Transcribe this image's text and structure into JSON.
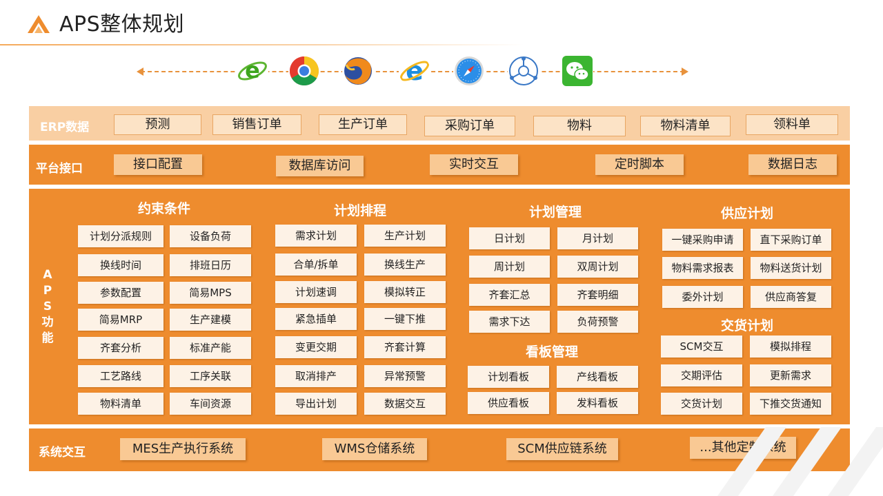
{
  "title": "APS整体规划",
  "colors": {
    "accent": "#ee8c2e",
    "light_band": "#f9cfa3",
    "cell": "#fdf2e6"
  },
  "browser_icons": [
    "ie-green-e-icon",
    "chrome-icon",
    "firefox-icon",
    "ie-blue-e-icon",
    "safari-icon",
    "network-hub-icon",
    "wechat-icon"
  ],
  "erp": {
    "label": "ERP数据",
    "items": [
      "预测",
      "销售订单",
      "生产订单",
      "采购订单",
      "物料",
      "物料清单",
      "领料单"
    ]
  },
  "platform": {
    "label": "平台接口",
    "items": [
      "接口配置",
      "数据库访问",
      "实时交互",
      "定时脚本",
      "数据日志"
    ]
  },
  "aps": {
    "label": [
      "A",
      "P",
      "S",
      "功",
      "能"
    ],
    "constraints": {
      "title": "约束条件",
      "items": [
        "计划分派规则",
        "设备负荷",
        "换线时间",
        "排班日历",
        "参数配置",
        "简易MPS",
        "简易MRP",
        "生产建模",
        "齐套分析",
        "标准产能",
        "工艺路线",
        "工序关联",
        "物料清单",
        "车间资源"
      ]
    },
    "scheduling": {
      "title": "计划排程",
      "items": [
        "需求计划",
        "生产计划",
        "合单/拆单",
        "换线生产",
        "计划速调",
        "模拟转正",
        "紧急插单",
        "一键下推",
        "变更交期",
        "齐套计算",
        "取消排产",
        "异常预警",
        "导出计划",
        "数据交互"
      ]
    },
    "plan_mgmt": {
      "title": "计划管理",
      "items": [
        "日计划",
        "月计划",
        "周计划",
        "双周计划",
        "齐套汇总",
        "齐套明细",
        "需求下达",
        "负荷预警"
      ]
    },
    "kanban": {
      "title": "看板管理",
      "items": [
        "计划看板",
        "产线看板",
        "供应看板",
        "发料看板"
      ]
    },
    "supply": {
      "title": "供应计划",
      "items": [
        "一键采购申请",
        "直下采购订单",
        "物料需求报表",
        "物料送货计划",
        "委外计划",
        "供应商答复"
      ]
    },
    "delivery": {
      "title": "交货计划",
      "items": [
        "SCM交互",
        "模拟排程",
        "交期评估",
        "更新需求",
        "交货计划",
        "下推交货通知"
      ]
    }
  },
  "system": {
    "label": "系统交互",
    "items": [
      "MES生产执行系统",
      "WMS仓储系统",
      "SCM供应链系统",
      "...其他定制系统"
    ]
  }
}
